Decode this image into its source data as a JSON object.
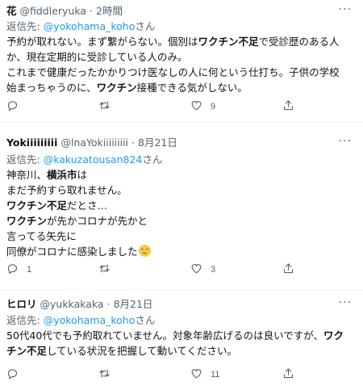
{
  "reply_prefix": "返信先:",
  "tweets": [
    {
      "name": "花",
      "handle": "@fiddleryuka",
      "dot": "·",
      "time": "2時間",
      "reply_to": "@yokohama_koho",
      "reply_suffix": "さん",
      "lines": [
        [
          {
            "t": "予約が取れない。まず繋がらない。個別は"
          },
          {
            "t": "ワクチン不足",
            "b": true
          },
          {
            "t": "で受診歴のある人"
          }
        ],
        [
          {
            "t": "か、現在定期的に受診している人のみ。"
          }
        ],
        [
          {
            "t": "これまで健康だったかかりつけ医なしの人に何という仕打ち。子供の学校"
          }
        ],
        [
          {
            "t": "始まっちゃうのに、"
          },
          {
            "t": "ワクチン",
            "b": true
          },
          {
            "t": "接種できる気がしない。"
          }
        ]
      ],
      "reply_count": "",
      "retweet_count": "",
      "like_count": "9"
    },
    {
      "name": "Yokiiiiiiiii",
      "handle": "@lnaYokiiiiiiiii",
      "dot": "·",
      "time": "8月21日",
      "reply_to": "@kakuzatousan824",
      "reply_suffix": "さん",
      "lines": [
        [
          {
            "t": "神奈川、"
          },
          {
            "t": "横浜市",
            "b": true
          },
          {
            "t": "は"
          }
        ],
        [
          {
            "t": "まだ予約すら取れません。"
          }
        ],
        [
          {
            "t": "ワクチン不足",
            "b": true
          },
          {
            "t": "だとさ…"
          }
        ],
        [
          {
            "t": "ワクチン",
            "b": true
          },
          {
            "t": "が先かコロナが先かと"
          }
        ],
        [
          {
            "t": "言ってる矢先に"
          }
        ],
        [
          {
            "t": "同僚がコロナに感染しました"
          },
          {
            "emoji": "grimace-emoji"
          }
        ]
      ],
      "reply_count": "1",
      "retweet_count": "",
      "like_count": "3"
    },
    {
      "name": "ヒロリ",
      "handle": "@yukkakaka",
      "dot": "·",
      "time": "8月21日",
      "reply_to": "@yokohama_koho",
      "reply_suffix": "さん",
      "lines": [
        [
          {
            "t": "50代40代でも予約取れていません。対象年齢広げるのは良いですが、"
          },
          {
            "t": "ワク",
            "b": true
          }
        ],
        [
          {
            "t": "チン不足",
            "b": true
          },
          {
            "t": "している状況を把握して動いてください。"
          }
        ]
      ],
      "reply_count": "",
      "retweet_count": "",
      "like_count": "11"
    }
  ],
  "more_label": "···",
  "colors": {
    "link": "#1d9bf0",
    "muted": "#536471",
    "text": "#0f1419",
    "divider": "#eff3f4"
  }
}
